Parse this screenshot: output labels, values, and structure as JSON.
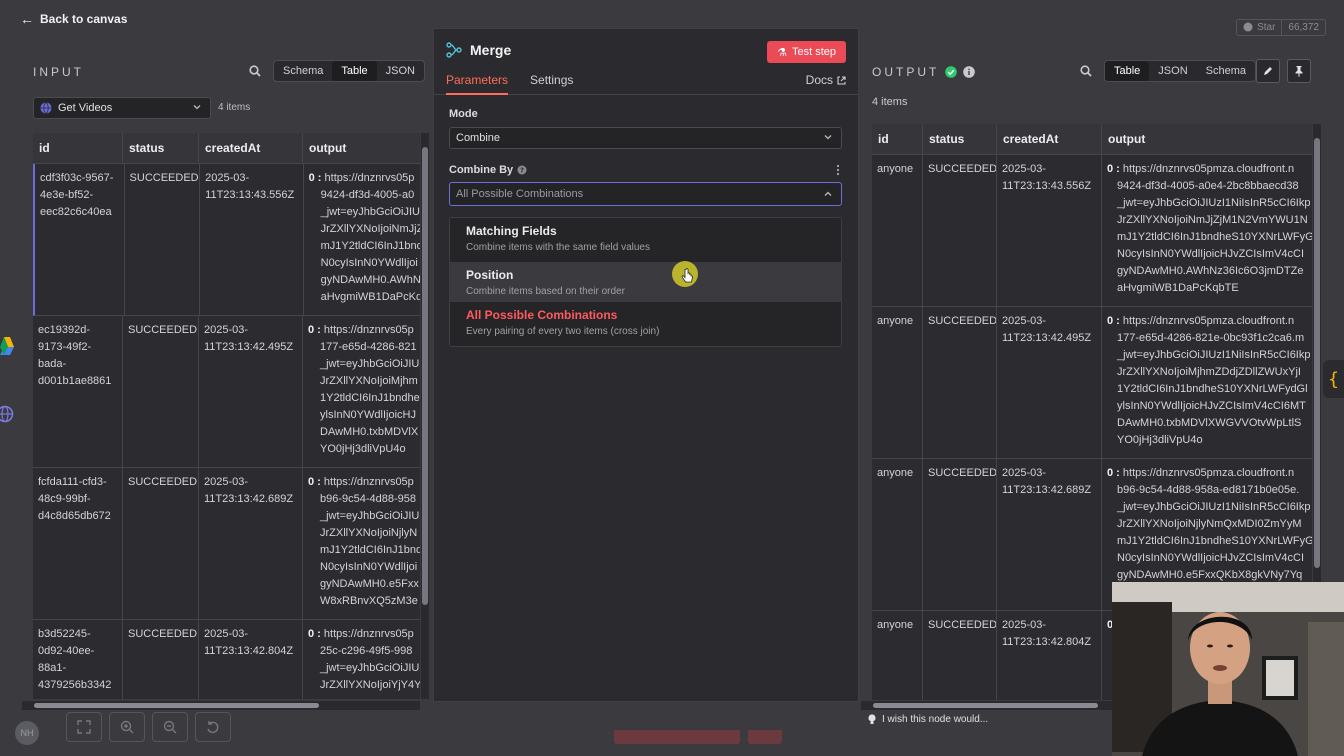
{
  "header": {
    "back_label": "Back to canvas",
    "github_star": "Star",
    "github_count": "66,372"
  },
  "input": {
    "title": "INPUT",
    "views": [
      "Schema",
      "Table",
      "JSON"
    ],
    "active_view": "Table",
    "source_node": "Get Videos",
    "item_count": "4 items",
    "columns": [
      "id",
      "status",
      "createdAt",
      "output"
    ],
    "rows": [
      {
        "id": [
          "cdf3f03c-9567-",
          "4e3e-bf52-",
          "eec82c6c40ea"
        ],
        "status": "SUCCEEDED",
        "createdAt": [
          "2025-03-",
          "11T23:13:43.556Z"
        ],
        "output": [
          "https://dnznrvs05p",
          "9424-df3d-4005-a0",
          "_jwt=eyJhbGciOiJIUz",
          "JrZXllYXNoIjoiNmJjZ",
          "mJ1Y2tldCI6InJ1bnd",
          "N0cyIsInN0YWdlIjoi",
          "gyNDAwMH0.AWhN",
          "aHvgmiWB1DaPcKq"
        ]
      },
      {
        "id": [
          "ec19392d-",
          "9173-49f2-",
          "bada-",
          "d001b1ae8861"
        ],
        "status": "SUCCEEDED",
        "createdAt": [
          "2025-03-",
          "11T23:13:42.495Z"
        ],
        "output": [
          "https://dnznrvs05p",
          "177-e65d-4286-821",
          "_jwt=eyJhbGciOiJIUz",
          "JrZXllYXNoIjoiMjhm",
          "1Y2tldCI6InJ1bndhe",
          "ylsInN0YWdlIjoicHJ",
          "DAwMH0.txbMDVlX",
          "YO0jHj3dliVpU4o"
        ]
      },
      {
        "id": [
          "fcfda111-cfd3-",
          "48c9-99bf-",
          "d4c8d65db672"
        ],
        "status": "SUCCEEDED",
        "createdAt": [
          "2025-03-",
          "11T23:13:42.689Z"
        ],
        "output": [
          "https://dnznrvs05p",
          "b96-9c54-4d88-958",
          "_jwt=eyJhbGciOiJIUz",
          "JrZXllYXNoIjoiNjlyN",
          "mJ1Y2tldCI6InJ1bnd",
          "N0cyIsInN0YWdlIjoi",
          "gyNDAwMH0.e5Fxx",
          "W8xRBnvXQ5zM3e"
        ]
      },
      {
        "id": [
          "b3d52245-",
          "0d92-40ee-",
          "88a1-",
          "4379256b3342"
        ],
        "status": "SUCCEEDED",
        "createdAt": [
          "2025-03-",
          "11T23:13:42.804Z"
        ],
        "output": [
          "https://dnznrvs05p",
          "25c-c296-49f5-998",
          "_jwt=eyJhbGciOiJIUz",
          "JrZXllYXNoIjoiYjY4Y"
        ]
      }
    ]
  },
  "modal": {
    "node_title": "Merge",
    "test_step_label": "Test step",
    "tabs": [
      "Parameters",
      "Settings"
    ],
    "active_tab": "Parameters",
    "docs_label": "Docs",
    "mode_label": "Mode",
    "mode_value": "Combine",
    "combine_by_label": "Combine By",
    "combine_by_value": "All Possible Combinations",
    "options": [
      {
        "title": "Matching Fields",
        "desc": "Combine items with the same field values"
      },
      {
        "title": "Position",
        "desc": "Combine items based on their order"
      },
      {
        "title": "All Possible Combinations",
        "desc": "Every pairing of every two items (cross join)"
      }
    ],
    "hovered_option": "Position",
    "selected_option": "All Possible Combinations"
  },
  "output": {
    "title": "OUTPUT",
    "views": [
      "Table",
      "JSON",
      "Schema"
    ],
    "active_view": "Table",
    "item_count": "4 items",
    "columns": [
      "id",
      "status",
      "createdAt",
      "output"
    ],
    "rows": [
      {
        "id": "anyone",
        "status": "SUCCEEDED",
        "createdAt": [
          "2025-03-",
          "11T23:13:43.556Z"
        ],
        "output": [
          "https://dnznrvs05pmza.cloudfront.n",
          "9424-df3d-4005-a0e4-2bc8bbaecd38",
          "_jwt=eyJhbGciOiJIUzI1NiIsInR5cCI6Ikp",
          "JrZXllYXNoIjoiNmJjZjM1N2VmYWU1N",
          "mJ1Y2tldCI6InJ1bndheS10YXNrLWFyG",
          "N0cyIsInN0YWdlIjoicHJvZCIsImV4cCI",
          "gyNDAwMH0.AWhNz36Ic6O3jmDTZe",
          "aHvgmiWB1DaPcKqbTE"
        ]
      },
      {
        "id": "anyone",
        "status": "SUCCEEDED",
        "createdAt": [
          "2025-03-",
          "11T23:13:42.495Z"
        ],
        "output": [
          "https://dnznrvs05pmza.cloudfront.n",
          "177-e65d-4286-821e-0bc93f1c2ca6.m",
          "_jwt=eyJhbGciOiJIUzI1NiIsInR5cCI6Ikp",
          "JrZXllYXNoIjoiMjhmZDdjZDllZWUxYjI",
          "1Y2tldCI6InJ1bndheS10YXNrLWFydGl",
          "ylsInN0YWdlIjoicHJvZCIsImV4cCI6MT",
          "DAwMH0.txbMDVlXWGVVOtvWpLtlS",
          "YO0jHj3dliVpU4o"
        ]
      },
      {
        "id": "anyone",
        "status": "SUCCEEDED",
        "createdAt": [
          "2025-03-",
          "11T23:13:42.689Z"
        ],
        "output": [
          "https://dnznrvs05pmza.cloudfront.n",
          "b96-9c54-4d88-958a-ed8171b0e05e.",
          "_jwt=eyJhbGciOiJIUzI1NiIsInR5cCI6Ikp",
          "JrZXllYXNoIjoiNjlyNmQxMDI0ZmYyM",
          "mJ1Y2tldCI6InJ1bndheS10YXNrLWFyG",
          "N0cyIsInN0YWdlIjoicHJvZCIsImV4cCI",
          "gyNDAwMH0.e5FxxQKbX8gkVNy7Yq"
        ]
      },
      {
        "id": "anyone",
        "status": "SUCCEEDED",
        "createdAt": [
          "2025-03-",
          "11T23:13:42.804Z"
        ],
        "output": [
          "0"
        ]
      }
    ]
  },
  "footer": {
    "avatar_initials": "NH",
    "feedback_text": "I wish this node would..."
  },
  "colors": {
    "accent": "#ff6d5a",
    "test_button": "#ea4b57",
    "success": "#2ecc71",
    "selected_option": "#ff5a5f"
  }
}
